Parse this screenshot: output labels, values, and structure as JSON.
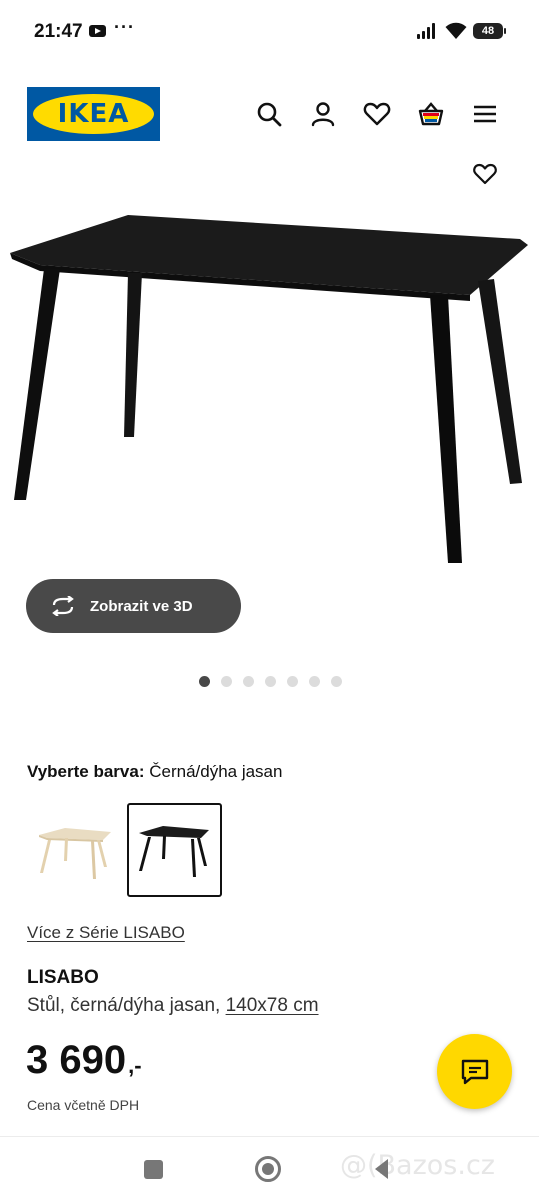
{
  "status_bar": {
    "time": "21:47",
    "more": "···",
    "battery": "48",
    "icons": [
      "youtube-icon",
      "signal-icon",
      "wifi-icon",
      "battery-icon"
    ]
  },
  "header": {
    "logo_text": "IKEA",
    "brand_colors": {
      "blue": "#0058a3",
      "yellow": "#ffdb00"
    },
    "icons": [
      "search-icon",
      "user-icon",
      "heart-icon",
      "basket-icon",
      "menu-icon"
    ]
  },
  "gallery": {
    "view_3d_label": "Zobrazit ve 3D",
    "dots_total": 7,
    "active_dot": 1
  },
  "colour": {
    "label": "Vyberte barva:",
    "value": "Černá/dýha jasan",
    "options": [
      "light-ash",
      "black"
    ],
    "selected": 2
  },
  "product": {
    "series_link": "Více z Série LISABO",
    "name": "LISABO",
    "description": "Stůl, černá/dýha jasan,",
    "size": "140x78 cm",
    "price": "3 690",
    "price_suffix": ",-",
    "price_note": "Cena včetně DPH"
  },
  "chat": {
    "accent": "#ffd800",
    "icon": "chat-icon"
  },
  "watermark": "@(Bazos.cz"
}
